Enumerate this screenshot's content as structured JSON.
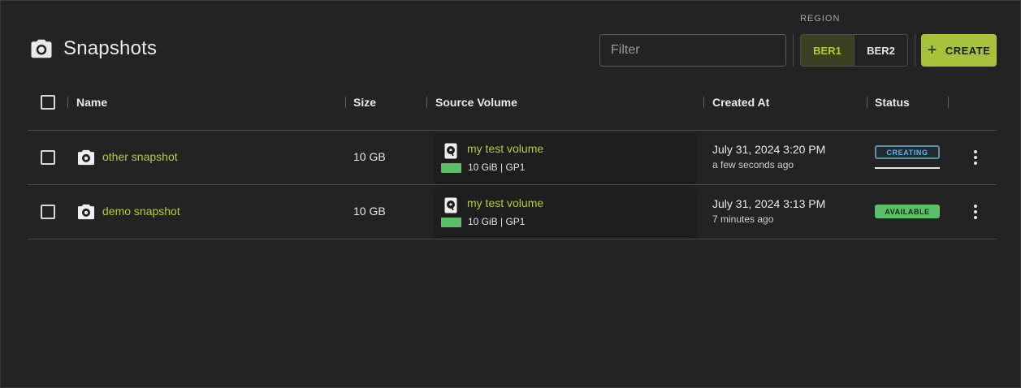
{
  "header": {
    "title": "Snapshots",
    "icon": "camera-icon",
    "filter_placeholder": "Filter",
    "region_label": "REGION",
    "regions": [
      {
        "label": "BER1",
        "active": true
      },
      {
        "label": "BER2",
        "active": false
      }
    ],
    "create_label": "CREATE"
  },
  "table": {
    "columns": [
      "Name",
      "Size",
      "Source Volume",
      "Created At",
      "Status"
    ],
    "rows": [
      {
        "name": "other snapshot",
        "size": "10 GB",
        "volume_name": "my test volume",
        "volume_meta": "10 GiB | GP1",
        "created": "July 31, 2024 3:20 PM",
        "created_rel": "a few seconds ago",
        "status": "CREATING"
      },
      {
        "name": "demo snapshot",
        "size": "10 GB",
        "volume_name": "my test volume",
        "volume_meta": "10 GiB | GP1",
        "created": "July 31, 2024 3:13 PM",
        "created_rel": "7 minutes ago",
        "status": "AVAILABLE"
      }
    ]
  },
  "colors": {
    "accent": "#b4cc35",
    "create_bg": "#a8c33b",
    "available": "#5cbd6b",
    "creating": "#5bb9e8"
  }
}
